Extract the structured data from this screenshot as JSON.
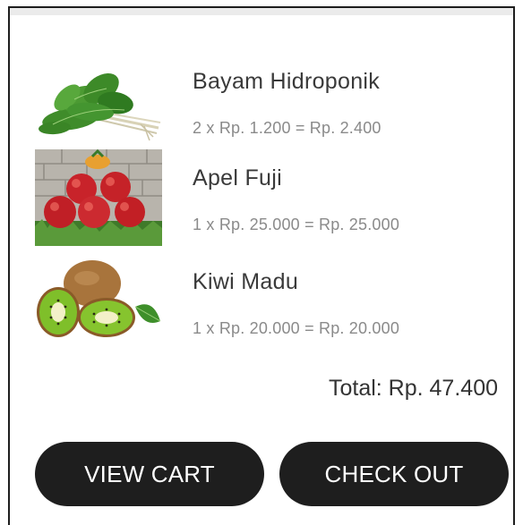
{
  "cart": {
    "items": [
      {
        "name": "Bayam Hidroponik",
        "line": "2 x Rp. 1.200 = Rp. 2.400",
        "image": "spinach-image"
      },
      {
        "name": "Apel Fuji",
        "line": "1 x Rp. 25.000 = Rp. 25.000",
        "image": "apple-image"
      },
      {
        "name": "Kiwi Madu",
        "line": "1 x Rp. 20.000 = Rp. 20.000",
        "image": "kiwi-image"
      }
    ],
    "total": "Total: Rp. 47.400",
    "view_cart_label": "VIEW CART",
    "checkout_label": "CHECK OUT"
  },
  "colors": {
    "button_bg": "#1e1e1e",
    "button_text": "#ffffff",
    "item_name": "#3a3a3a",
    "item_price": "#8a8a8a"
  }
}
